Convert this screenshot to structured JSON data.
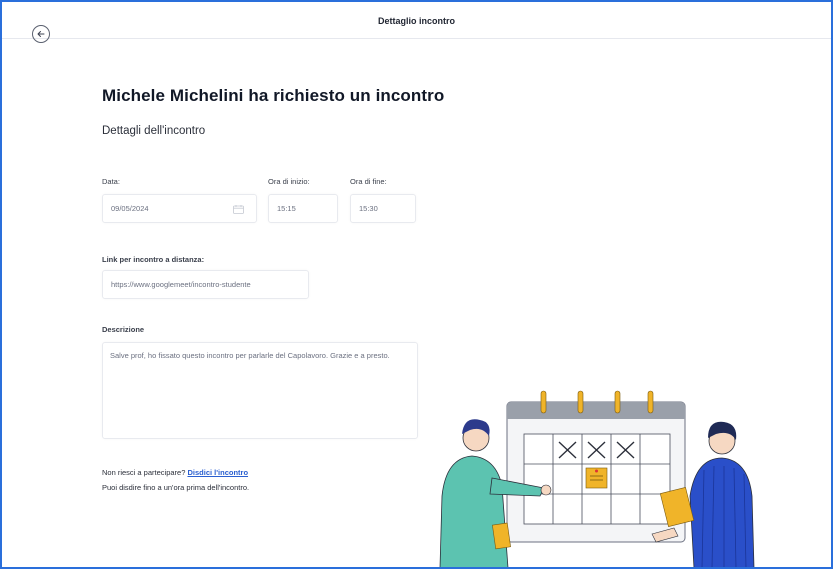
{
  "header": {
    "title": "Dettaglio incontro",
    "back_icon": "arrow-left-circle-icon"
  },
  "page": {
    "title": "Michele Michelini ha richiesto un incontro",
    "subtitle": "Dettagli dell'incontro"
  },
  "form": {
    "date_label": "Data:",
    "date_value": "09/05/2024",
    "start_label": "Ora di inizio:",
    "start_value": "15:15",
    "end_label": "Ora di fine:",
    "end_value": "15:30",
    "link_label": "Link per incontro a distanza:",
    "link_value": "https://www.googlemeet/incontro-studente",
    "description_label": "Descrizione",
    "description_value": "Salve prof, ho fissato questo incontro per parlarle del Capolavoro. Grazie e a presto."
  },
  "cancel": {
    "question": "Non riesci a partecipare?",
    "link_label": "Disdici l'incontro",
    "note": "Puoi disdire fino a un'ora prima dell'incontro."
  },
  "colors": {
    "accent": "#2a6fdb",
    "link": "#2a5fd0",
    "calendar_ring": "#f0b429"
  }
}
